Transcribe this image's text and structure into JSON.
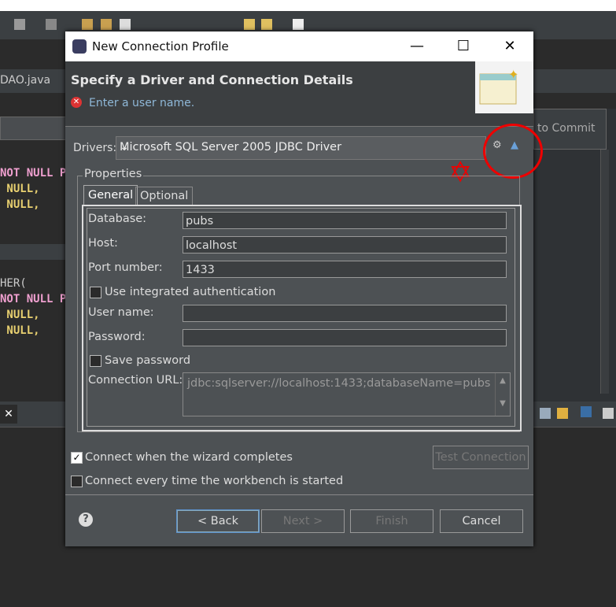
{
  "background": {
    "editor_tab": "DAO.java",
    "auto_commit": "to Commit",
    "code_lines": [
      "NOT NULL P",
      " NULL,",
      " NULL,",
      "",
      "",
      "HER(",
      "NOT NULL P",
      " NULL,",
      " NULL,"
    ],
    "close_glyph": "✕"
  },
  "dialog": {
    "title": "New Connection Profile",
    "window_buttons": {
      "minimize": "—",
      "maximize": "☐",
      "close": "✕"
    },
    "banner": {
      "title": "Specify a Driver and Connection Details",
      "error": "Enter a user name."
    },
    "drivers": {
      "label": "Drivers:",
      "value": "Microsoft SQL Server 2005 JDBC Driver"
    },
    "properties": {
      "label": "Properties",
      "tabs": [
        "General",
        "Optional"
      ],
      "fields": {
        "database": {
          "label": "Database:",
          "value": "pubs"
        },
        "host": {
          "label": "Host:",
          "value": "localhost"
        },
        "port": {
          "label": "Port number:",
          "value": "1433"
        },
        "integrated": {
          "label": "Use integrated authentication",
          "checked": false
        },
        "user": {
          "label": "User name:",
          "value": ""
        },
        "password": {
          "label": "Password:",
          "value": ""
        },
        "save_password": {
          "label": "Save password",
          "checked": false
        },
        "url": {
          "label": "Connection URL:",
          "value": "jdbc:sqlserver://localhost:1433;databaseName=pubs"
        }
      }
    },
    "connect_on_complete": {
      "label": "Connect when the wizard completes",
      "checked": true
    },
    "connect_every_time": {
      "label": "Connect every time the workbench is started",
      "checked": false
    },
    "buttons": {
      "test": "Test Connection",
      "back": "< Back",
      "next": "Next >",
      "finish": "Finish",
      "cancel": "Cancel",
      "help": "?"
    }
  },
  "colors": {
    "annotation": "#e00000",
    "dialog_bg": "#4d5154"
  }
}
